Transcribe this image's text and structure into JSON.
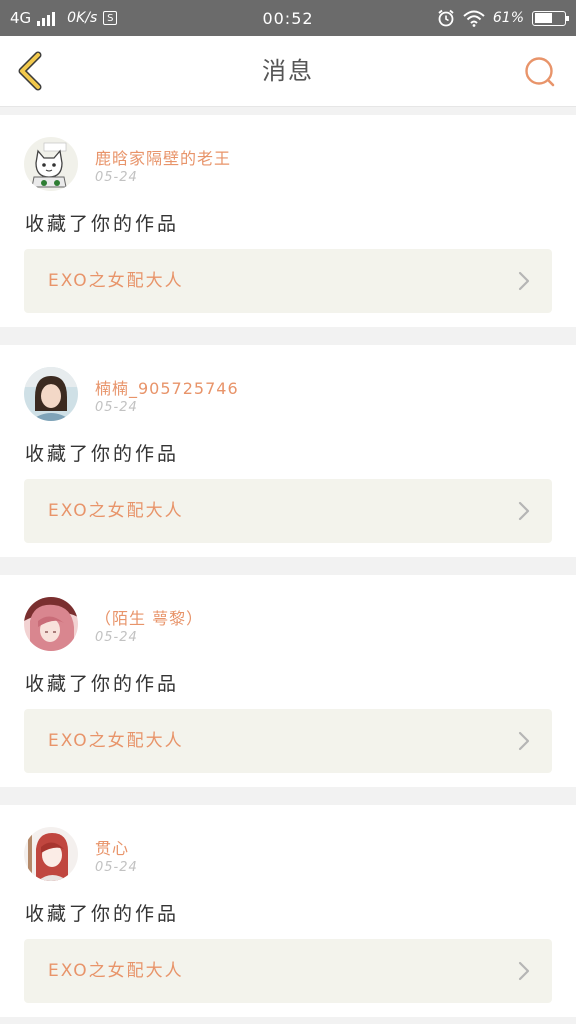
{
  "status_bar": {
    "network": "4G",
    "speed": "0K/s",
    "s_icon_label": "S",
    "time": "00:52",
    "battery": "61%",
    "battery_level": 0.61
  },
  "header": {
    "back_icon": "chevron-left-icon",
    "title": "消息",
    "search_icon": "search-icon"
  },
  "messages": [
    {
      "username": "鹿晗家隔壁的老王",
      "date": "05-24",
      "action": "收藏了你的作品",
      "work_title": "EXO之女配大人",
      "avatar": "cat-cartoon-avatar"
    },
    {
      "username": "楠楠_905725746",
      "date": "05-24",
      "action": "收藏了你的作品",
      "work_title": "EXO之女配大人",
      "avatar": "girl-photo-avatar"
    },
    {
      "username": "（陌生 萼黎）",
      "date": "05-24",
      "action": "收藏了你的作品",
      "work_title": "EXO之女配大人",
      "avatar": "pink-hair-girl-avatar"
    },
    {
      "username": "贯心",
      "date": "05-24",
      "action": "收藏了你的作品",
      "work_title": "EXO之女配大人",
      "avatar": "red-hair-portrait-avatar"
    }
  ],
  "colors": {
    "accent": "#e8946a",
    "back_icon": "#f2c94c",
    "status_bar": "#6b6b6b",
    "card_link_bg": "#f3f3ec"
  }
}
